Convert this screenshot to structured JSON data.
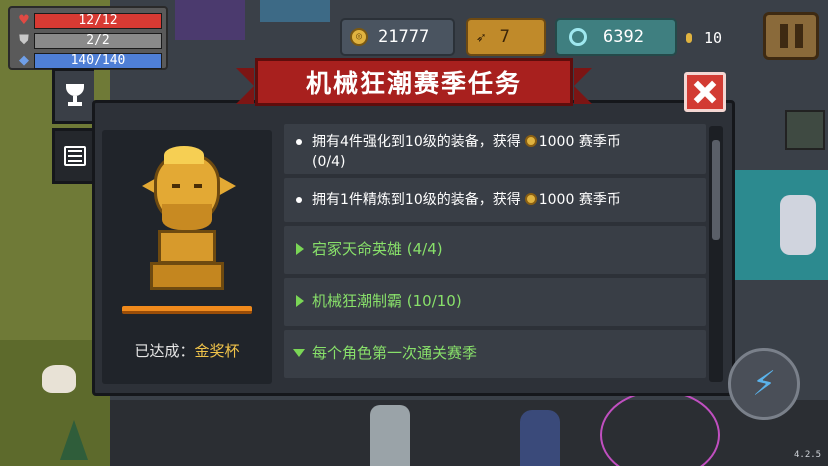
{
  "hud": {
    "hp": "12/12",
    "armor": "2/2",
    "energy": "140/140",
    "coins": "21777",
    "feathers": "7",
    "gems": "6392",
    "currency": "10"
  },
  "dialog": {
    "title": "机械狂潮赛季任务",
    "reward": {
      "status_label": "已达成：",
      "status_value": "金奖杯"
    },
    "tasks": [
      {
        "text_a": "拥有4件强化到10级的装备，获得",
        "reward": "1000 赛季币",
        "progress": "(0/4)"
      },
      {
        "text_a": "拥有1件精炼到10级的装备，获得",
        "reward": "1000 赛季币"
      }
    ],
    "groups": [
      {
        "label": "宕冢天命英雄 (4/4)",
        "expanded": false
      },
      {
        "label": "机械狂潮制霸 (10/10)",
        "expanded": false
      },
      {
        "label": "每个角色第一次通关赛季",
        "expanded": true
      }
    ]
  },
  "icons": {
    "tab_trophy": "trophy-icon",
    "tab_list": "list-icon",
    "close": "close-icon",
    "pause": "pause-icon",
    "skill": "lightning-icon"
  },
  "colors": {
    "ribbon": "#a8201e",
    "close": "#d23b33",
    "group_green": "#88e06a",
    "gold_text": "#f0c34a"
  },
  "version": "4.2.5"
}
